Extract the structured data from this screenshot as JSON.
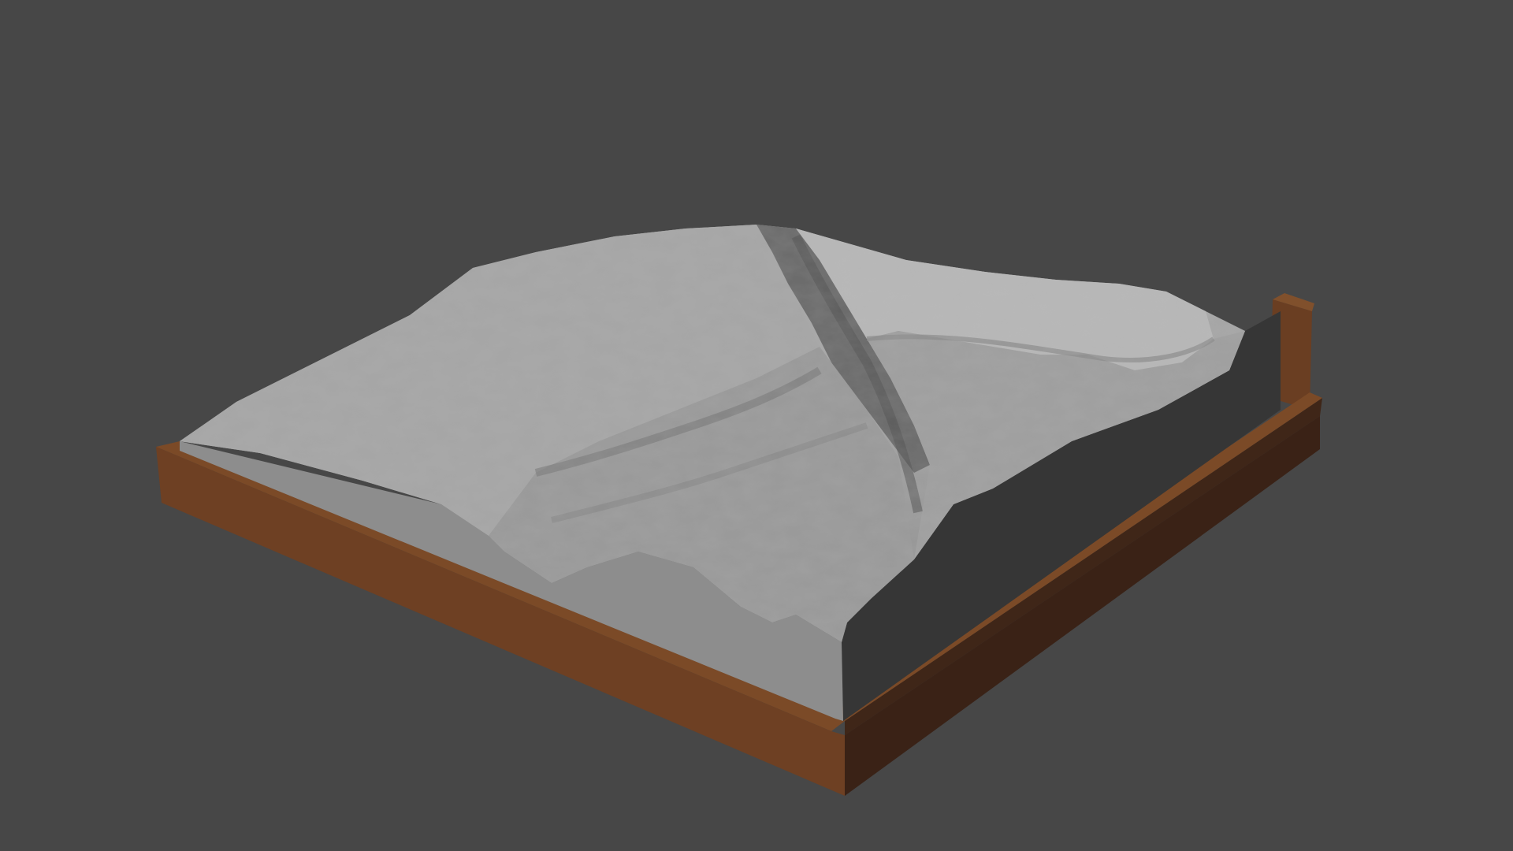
{
  "viewport": {
    "background_color": "#474747",
    "object": "terrain-relief-model",
    "materials": {
      "terrain_light": "#a9a9a9",
      "terrain_mid": "#8e8e8e",
      "terrain_shadow": "#5c5c5c",
      "side_wall": "#363636",
      "base_wood_front": "#6f4124",
      "base_wood_side": "#40261a",
      "base_wood_top": "#7a4826"
    }
  }
}
